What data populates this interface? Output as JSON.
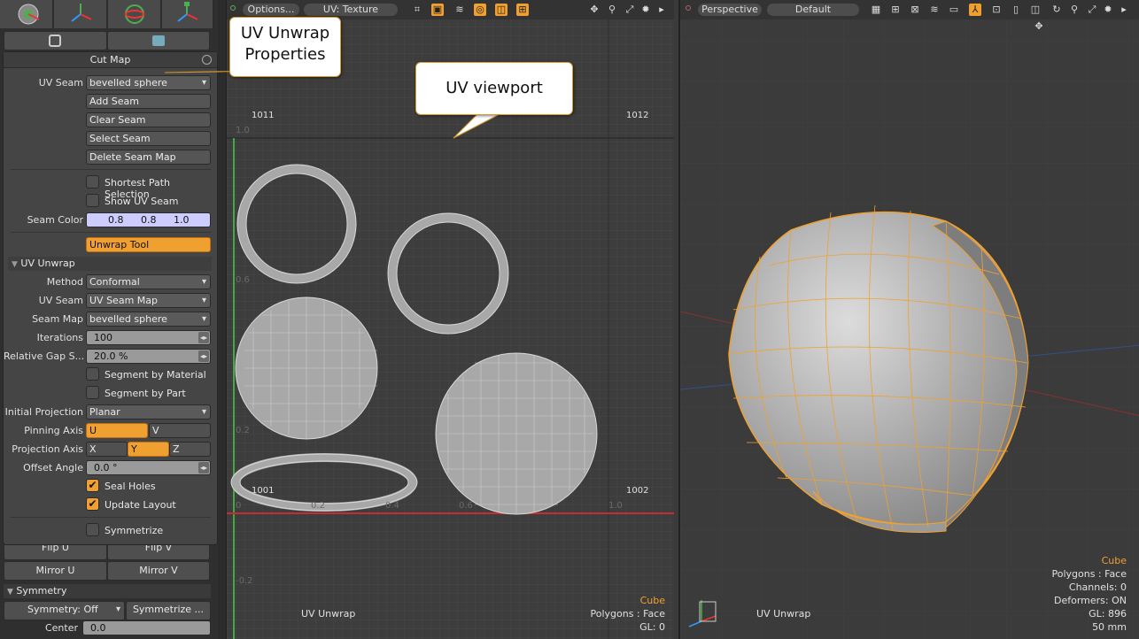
{
  "left_panel": {
    "tool_tabs": [
      "tool-1",
      "tool-2",
      "tool-3",
      "tool-4"
    ],
    "panel_title": "Cut Map",
    "uv_seam_label": "UV Seam",
    "uv_seam_value": "bevelled sphere",
    "buttons": {
      "add_seam": "Add Seam",
      "clear_seam": "Clear Seam",
      "select_seam": "Select Seam",
      "delete_seam_map": "Delete Seam Map"
    },
    "shortest_path": "Shortest Path Selection",
    "show_uv_seam": "Show UV Seam",
    "seam_color_label": "Seam Color",
    "seam_color_values": [
      "0.8",
      "0.8",
      "1.0"
    ],
    "unwrap_tool": "Unwrap Tool",
    "uv_unwrap_section": "UV Unwrap",
    "method_label": "Method",
    "method_value": "Conformal",
    "uv_seam2_label": "UV Seam",
    "uv_seam2_value": "UV Seam Map",
    "seam_map_label": "Seam Map",
    "seam_map_value": "bevelled sphere",
    "iterations_label": "Iterations",
    "iterations_value": "100",
    "gap_label": "Relative Gap S...",
    "gap_value": "20.0 %",
    "segment_material": "Segment by Material",
    "segment_part": "Segment by Part",
    "initial_proj_label": "Initial Projection",
    "initial_proj_value": "Planar",
    "pinning_label": "Pinning Axis",
    "pinning_u": "U",
    "pinning_v": "V",
    "projection_label": "Projection Axis",
    "proj_x": "X",
    "proj_y": "Y",
    "proj_z": "Z",
    "offset_label": "Offset Angle",
    "offset_value": "0.0 °",
    "seal_holes": "Seal Holes",
    "update_layout": "Update Layout",
    "symmetrize": "Symmetrize",
    "flip_u": "Flip U",
    "flip_v": "Flip V",
    "mirror_u": "Mirror U",
    "mirror_v": "Mirror V",
    "symmetry_section": "Symmetry",
    "symmetry_value": "Symmetry: Off",
    "symmetrize_btn": "Symmetrize ...",
    "center_label": "Center",
    "center_value": "0.0"
  },
  "uv_view": {
    "options_btn": "Options...",
    "texture_btn": "UV: Texture",
    "tile_labels": {
      "tl": "1011",
      "tr": "1012",
      "bl": "1001",
      "br": "1002"
    },
    "axis_labels": {
      "y10": "1.0",
      "y06": "0.6",
      "y02": "0.2",
      "yneg": "-0.2",
      "x0": "0",
      "x02": "0.2",
      "x04": "0.4",
      "x06": "0.6",
      "x10": "1.0"
    },
    "footer_left": "UV Unwrap",
    "item_name": "Cube",
    "polygons": "Polygons : Face",
    "gl": "GL: 0"
  },
  "persp_view": {
    "view_btn": "Perspective",
    "shade_btn": "Default",
    "footer_left": "UV Unwrap",
    "item_name": "Cube",
    "polygons": "Polygons : Face",
    "channels": "Channels: 0",
    "deformers": "Deformers: ON",
    "gl": "GL: 896",
    "focal": "50 mm"
  },
  "callouts": {
    "props": "UV Unwrap\nProperties",
    "viewport": "UV viewport"
  },
  "colors": {
    "accent": "#f0a030",
    "seam_color": "#ccccff"
  }
}
